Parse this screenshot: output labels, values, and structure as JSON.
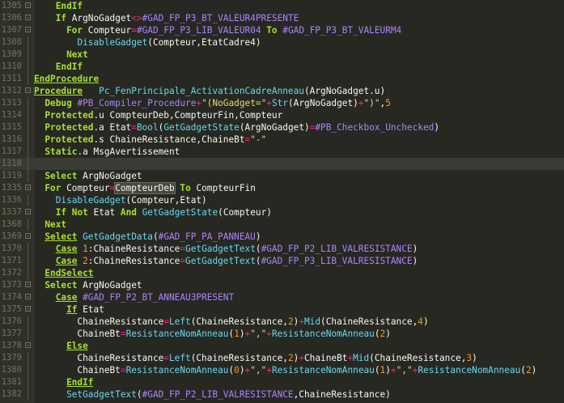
{
  "editor": {
    "lines": [
      {
        "num": "1305",
        "fold": "-",
        "tokens": [
          {
            "t": "    "
          },
          {
            "t": "EndIf",
            "c": "kw"
          }
        ]
      },
      {
        "num": "1306",
        "fold": "-",
        "tokens": [
          {
            "t": "    "
          },
          {
            "t": "If",
            "c": "kw"
          },
          {
            "t": " ArgNoGadget"
          },
          {
            "t": "<>",
            "c": "op"
          },
          {
            "t": "#GAD_FP_P3_BT_VALEUR4PRESENTE",
            "c": "cn"
          }
        ]
      },
      {
        "num": "1307",
        "fold": "-",
        "tokens": [
          {
            "t": "      "
          },
          {
            "t": "For",
            "c": "kw"
          },
          {
            "t": " Compteur"
          },
          {
            "t": "=",
            "c": "op"
          },
          {
            "t": "#GAD_FP_P3_LIB_VALEUR04",
            "c": "cn"
          },
          {
            "t": " "
          },
          {
            "t": "To",
            "c": "kw"
          },
          {
            "t": " "
          },
          {
            "t": "#GAD_FP_P3_BT_VALEURM4",
            "c": "cn"
          }
        ]
      },
      {
        "num": "1308",
        "fold": "|",
        "tokens": [
          {
            "t": "        "
          },
          {
            "t": "DisableGadget",
            "c": "fn"
          },
          {
            "t": "(Compteur,EtatCadre4)"
          }
        ]
      },
      {
        "num": "1309",
        "fold": "|",
        "tokens": [
          {
            "t": "      "
          },
          {
            "t": "Next",
            "c": "kw"
          }
        ]
      },
      {
        "num": "1310",
        "fold": "|",
        "tokens": [
          {
            "t": "    "
          },
          {
            "t": "EndIf",
            "c": "kw"
          }
        ]
      },
      {
        "num": "1311",
        "fold": "|",
        "tokens": [
          {
            "t": "EndProcedure",
            "c": "kw ul"
          }
        ]
      },
      {
        "num": "1312",
        "fold": "-",
        "tokens": [
          {
            "t": "Procedure",
            "c": "kw ul"
          },
          {
            "t": "   "
          },
          {
            "t": "Pc_FenPrincipale_ActivationCadreAnneau",
            "c": "fn"
          },
          {
            "t": "(ArgNoGadget.u)"
          }
        ]
      },
      {
        "num": "1313",
        "fold": "|",
        "tokens": [
          {
            "t": "  "
          },
          {
            "t": "Debug",
            "c": "kw"
          },
          {
            "t": " "
          },
          {
            "t": "#PB_Compiler_Procedure",
            "c": "cn"
          },
          {
            "t": "+",
            "c": "op"
          },
          {
            "t": "\"(NoGadget=\"",
            "c": "st"
          },
          {
            "t": "+",
            "c": "op"
          },
          {
            "t": "Str",
            "c": "fn"
          },
          {
            "t": "(ArgNoGadget)"
          },
          {
            "t": "+",
            "c": "op"
          },
          {
            "t": "\")\"",
            "c": "st"
          },
          {
            "t": ","
          },
          {
            "t": "5",
            "c": "nu"
          }
        ]
      },
      {
        "num": "1314",
        "fold": "|",
        "tokens": [
          {
            "t": "  "
          },
          {
            "t": "Protected",
            "c": "kw"
          },
          {
            "t": ".u CompteurDeb,CompteurFin,Compteur"
          }
        ]
      },
      {
        "num": "1315",
        "fold": "|",
        "tokens": [
          {
            "t": "  "
          },
          {
            "t": "Protected",
            "c": "kw"
          },
          {
            "t": ".a Etat"
          },
          {
            "t": "=",
            "c": "op"
          },
          {
            "t": "Bool",
            "c": "fn"
          },
          {
            "t": "("
          },
          {
            "t": "GetGadgetState",
            "c": "fn"
          },
          {
            "t": "(ArgNoGadget)"
          },
          {
            "t": "=",
            "c": "op"
          },
          {
            "t": "#PB_Checkbox_Unchecked",
            "c": "cn"
          },
          {
            "t": ")"
          }
        ]
      },
      {
        "num": "1316",
        "fold": "|",
        "tokens": [
          {
            "t": "  "
          },
          {
            "t": "Protected",
            "c": "kw"
          },
          {
            "t": ".s ChaineResistance,ChaineBt"
          },
          {
            "t": "=",
            "c": "op"
          },
          {
            "t": "\"-\"",
            "c": "st"
          }
        ]
      },
      {
        "num": "1317",
        "fold": "|",
        "tokens": [
          {
            "t": "  "
          },
          {
            "t": "Static",
            "c": "kw"
          },
          {
            "t": ".a MsgAvertissement"
          }
        ]
      },
      {
        "num": "1318",
        "fold": "|",
        "tokens": [],
        "current": true
      },
      {
        "num": "1319",
        "fold": "|",
        "tokens": [
          {
            "t": "  "
          },
          {
            "t": "Select",
            "c": "kw"
          },
          {
            "t": " ArgNoGadget"
          }
        ]
      },
      {
        "num": "1335",
        "fold": "-",
        "tokens": [
          {
            "t": "  "
          },
          {
            "t": "For",
            "c": "kw"
          },
          {
            "t": " Compteur"
          },
          {
            "t": "=",
            "c": "op"
          },
          {
            "t": "CompteurDeb",
            "hl": true
          },
          {
            "t": " "
          },
          {
            "t": "To",
            "c": "kw"
          },
          {
            "t": " CompteurFin"
          }
        ]
      },
      {
        "num": "1336",
        "fold": "|",
        "tokens": [
          {
            "t": "    "
          },
          {
            "t": "DisableGadget",
            "c": "fn"
          },
          {
            "t": "(Compteur,Etat)"
          }
        ]
      },
      {
        "num": "1337",
        "fold": "-",
        "tokens": [
          {
            "t": "    "
          },
          {
            "t": "If",
            "c": "kw"
          },
          {
            "t": " "
          },
          {
            "t": "Not",
            "c": "kw"
          },
          {
            "t": " Etat "
          },
          {
            "t": "And",
            "c": "kw"
          },
          {
            "t": " "
          },
          {
            "t": "GetGadgetState",
            "c": "fn"
          },
          {
            "t": "(Compteur)"
          }
        ]
      },
      {
        "num": "1368",
        "fold": "|",
        "tokens": [
          {
            "t": "  "
          },
          {
            "t": "Next",
            "c": "kw"
          }
        ]
      },
      {
        "num": "1369",
        "fold": "-",
        "tokens": [
          {
            "t": "  "
          },
          {
            "t": "Select",
            "c": "kw ul"
          },
          {
            "t": " "
          },
          {
            "t": "GetGadgetData",
            "c": "fn"
          },
          {
            "t": "("
          },
          {
            "t": "#GAD_FP_PA_PANNEAU",
            "c": "cn"
          },
          {
            "t": ")"
          }
        ]
      },
      {
        "num": "1370",
        "fold": "|",
        "tokens": [
          {
            "t": "    "
          },
          {
            "t": "Case",
            "c": "kw ul"
          },
          {
            "t": " "
          },
          {
            "t": "1",
            "c": "nu"
          },
          {
            "t": ":ChaineResistance"
          },
          {
            "t": "=",
            "c": "op"
          },
          {
            "t": "GetGadgetText",
            "c": "fn"
          },
          {
            "t": "("
          },
          {
            "t": "#GAD_FP_P2_LIB_VALRESISTANCE",
            "c": "cn"
          },
          {
            "t": ")"
          }
        ]
      },
      {
        "num": "1371",
        "fold": "|",
        "tokens": [
          {
            "t": "    "
          },
          {
            "t": "Case",
            "c": "kw ul"
          },
          {
            "t": " "
          },
          {
            "t": "2",
            "c": "nu"
          },
          {
            "t": ":ChaineResistance"
          },
          {
            "t": "=",
            "c": "op"
          },
          {
            "t": "GetGadgetText",
            "c": "fn"
          },
          {
            "t": "("
          },
          {
            "t": "#GAD_FP_P3_LIB_VALRESISTANCE",
            "c": "cn"
          },
          {
            "t": ")"
          }
        ]
      },
      {
        "num": "1372",
        "fold": "|",
        "tokens": [
          {
            "t": "  "
          },
          {
            "t": "EndSelect",
            "c": "kw ul"
          }
        ]
      },
      {
        "num": "1373",
        "fold": "-",
        "tokens": [
          {
            "t": "  "
          },
          {
            "t": "Select",
            "c": "kw"
          },
          {
            "t": " ArgNoGadget"
          }
        ]
      },
      {
        "num": "1374",
        "fold": "-",
        "tokens": [
          {
            "t": "    "
          },
          {
            "t": "Case",
            "c": "kw ul"
          },
          {
            "t": " "
          },
          {
            "t": "#GAD_FP_P2_BT_ANNEAU3PRESENT",
            "c": "cn"
          }
        ]
      },
      {
        "num": "1375",
        "fold": "-",
        "tokens": [
          {
            "t": "      "
          },
          {
            "t": "If",
            "c": "kw ul"
          },
          {
            "t": " Etat"
          }
        ]
      },
      {
        "num": "1376",
        "fold": "|",
        "tokens": [
          {
            "t": "        ChaineResistance"
          },
          {
            "t": "=",
            "c": "op"
          },
          {
            "t": "Left",
            "c": "fn"
          },
          {
            "t": "(ChaineResistance,"
          },
          {
            "t": "2",
            "c": "nu"
          },
          {
            "t": ")"
          },
          {
            "t": "+",
            "c": "op"
          },
          {
            "t": "Mid",
            "c": "fn"
          },
          {
            "t": "(ChaineResistance,"
          },
          {
            "t": "4",
            "c": "nu"
          },
          {
            "t": ")"
          }
        ]
      },
      {
        "num": "1377",
        "fold": "|",
        "tokens": [
          {
            "t": "        ChaineBt"
          },
          {
            "t": "=",
            "c": "op"
          },
          {
            "t": "ResistanceNomAnneau",
            "c": "fn"
          },
          {
            "t": "("
          },
          {
            "t": "1",
            "c": "nu"
          },
          {
            "t": ")"
          },
          {
            "t": "+",
            "c": "op"
          },
          {
            "t": "\",\"",
            "c": "st"
          },
          {
            "t": "+",
            "c": "op"
          },
          {
            "t": "ResistanceNomAnneau",
            "c": "fn"
          },
          {
            "t": "("
          },
          {
            "t": "2",
            "c": "nu"
          },
          {
            "t": ")"
          }
        ]
      },
      {
        "num": "1378",
        "fold": "-",
        "tokens": [
          {
            "t": "      "
          },
          {
            "t": "Else",
            "c": "kw ul"
          }
        ]
      },
      {
        "num": "1379",
        "fold": "|",
        "tokens": [
          {
            "t": "        ChaineResistance"
          },
          {
            "t": "=",
            "c": "op"
          },
          {
            "t": "Left",
            "c": "fn"
          },
          {
            "t": "(ChaineResistance,"
          },
          {
            "t": "2",
            "c": "nu"
          },
          {
            "t": ")"
          },
          {
            "t": "+",
            "c": "op"
          },
          {
            "t": "ChaineBt"
          },
          {
            "t": "+",
            "c": "op"
          },
          {
            "t": "Mid",
            "c": "fn"
          },
          {
            "t": "(ChaineResistance,"
          },
          {
            "t": "3",
            "c": "nu"
          },
          {
            "t": ")"
          }
        ]
      },
      {
        "num": "1380",
        "fold": "|",
        "tokens": [
          {
            "t": "        ChaineBt"
          },
          {
            "t": "=",
            "c": "op"
          },
          {
            "t": "ResistanceNomAnneau",
            "c": "fn"
          },
          {
            "t": "("
          },
          {
            "t": "0",
            "c": "nu"
          },
          {
            "t": ")"
          },
          {
            "t": "+",
            "c": "op"
          },
          {
            "t": "\",\"",
            "c": "st"
          },
          {
            "t": "+",
            "c": "op"
          },
          {
            "t": "ResistanceNomAnneau",
            "c": "fn"
          },
          {
            "t": "("
          },
          {
            "t": "1",
            "c": "nu"
          },
          {
            "t": ")"
          },
          {
            "t": "+",
            "c": "op"
          },
          {
            "t": "\",\"",
            "c": "st"
          },
          {
            "t": "+",
            "c": "op"
          },
          {
            "t": "ResistanceNomAnneau",
            "c": "fn"
          },
          {
            "t": "("
          },
          {
            "t": "2",
            "c": "nu"
          },
          {
            "t": ")"
          }
        ]
      },
      {
        "num": "1381",
        "fold": "|",
        "tokens": [
          {
            "t": "      "
          },
          {
            "t": "EndIf",
            "c": "kw ul"
          }
        ]
      },
      {
        "num": "1382",
        "fold": "|",
        "tokens": [
          {
            "t": "      "
          },
          {
            "t": "SetGadgetText",
            "c": "fn"
          },
          {
            "t": "("
          },
          {
            "t": "#GAD_FP_P2_LIB_VALRESISTANCE",
            "c": "cn"
          },
          {
            "t": ",ChaineResistance)"
          }
        ]
      }
    ]
  },
  "colors": {
    "background": "#272822",
    "keyword": "#a6e22e",
    "function": "#66d9ef",
    "constant": "#ae81ff",
    "string": "#e6db74",
    "number": "#fd971f",
    "operator": "#f92672",
    "line_number": "#75715e"
  }
}
